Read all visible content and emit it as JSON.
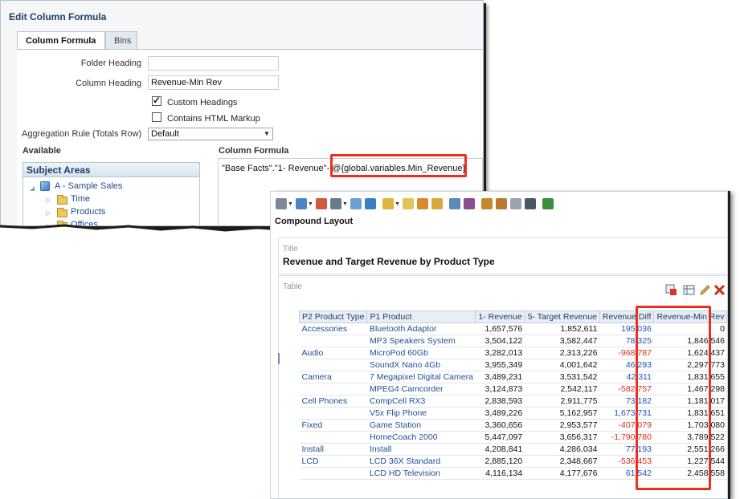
{
  "dialog": {
    "title": "Edit Column Formula",
    "tabs": [
      {
        "label": "Column Formula",
        "active": true
      },
      {
        "label": "Bins",
        "active": false
      }
    ],
    "folder_heading_label": "Folder Heading",
    "folder_heading_value": "",
    "column_heading_label": "Column Heading",
    "column_heading_value": "Revenue-Min Rev",
    "custom_headings_label": "Custom Headings",
    "custom_headings_checked": true,
    "html_markup_label": "Contains HTML Markup",
    "html_markup_checked": false,
    "aggregation_label": "Aggregation Rule (Totals Row)",
    "aggregation_value": "Default",
    "available_label": "Available",
    "subject_areas_label": "Subject Areas",
    "tree": [
      {
        "label": "A - Sample Sales",
        "kind": "subject-area",
        "expanded": true
      },
      {
        "label": "Time",
        "kind": "folder"
      },
      {
        "label": "Products",
        "kind": "folder"
      },
      {
        "label": "Offices",
        "kind": "folder"
      }
    ],
    "column_formula_label": "Column Formula",
    "formula_prefix": "\"Base Facts\".\"1- Revenue\"-",
    "formula_variable": "@{global.variables.Min_Revenue}"
  },
  "panel": {
    "compound_title": "Compound Layout",
    "title_view_label": "Title",
    "view_title": "Revenue and Target Revenue by Product Type",
    "table_view_label": "Table",
    "icons": [
      "format-view-icon",
      "edit-view-icon",
      "pencil-icon",
      "delete-icon"
    ],
    "table": {
      "headers": [
        "P2 Product Type",
        "P1 Product",
        "1- Revenue",
        "5- Target Revenue",
        "Revenue Diff",
        "Revenue-Min Rev"
      ],
      "rows": [
        {
          "type": "Accessories",
          "product": "Bluetooth Adaptor",
          "revenue": "1,657,576",
          "target": "1,852,611",
          "diff": "195,036",
          "diff_neg": false,
          "minrev": "0"
        },
        {
          "type": "",
          "product": "MP3 Speakers System",
          "revenue": "3,504,122",
          "target": "3,582,447",
          "diff": "78,325",
          "diff_neg": false,
          "minrev": "1,846,546"
        },
        {
          "type": "Audio",
          "product": "MicroPod 60Gb",
          "revenue": "3,282,013",
          "target": "2,313,226",
          "diff": "-968,787",
          "diff_neg": true,
          "minrev": "1,624,437"
        },
        {
          "type": "",
          "product": "SoundX Nano 4Gb",
          "revenue": "3,955,349",
          "target": "4,001,642",
          "diff": "46,293",
          "diff_neg": false,
          "minrev": "2,297,773"
        },
        {
          "type": "Camera",
          "product": "7 Megapixel Digital Camera",
          "revenue": "3,489,231",
          "target": "3,531,542",
          "diff": "42,311",
          "diff_neg": false,
          "minrev": "1,831,655"
        },
        {
          "type": "",
          "product": "MPEG4 Camcorder",
          "revenue": "3,124,873",
          "target": "2,542,117",
          "diff": "-582,757",
          "diff_neg": true,
          "minrev": "1,467,298"
        },
        {
          "type": "Cell Phones",
          "product": "CompCell RX3",
          "revenue": "2,838,593",
          "target": "2,911,775",
          "diff": "73,182",
          "diff_neg": false,
          "minrev": "1,181,017"
        },
        {
          "type": "",
          "product": "V5x Flip Phone",
          "revenue": "3,489,226",
          "target": "5,162,957",
          "diff": "1,673,731",
          "diff_neg": false,
          "minrev": "1,831,651"
        },
        {
          "type": "Fixed",
          "product": "Game Station",
          "revenue": "3,360,656",
          "target": "2,953,577",
          "diff": "-407,079",
          "diff_neg": true,
          "minrev": "1,703,080"
        },
        {
          "type": "",
          "product": "HomeCoach 2000",
          "revenue": "5,447,097",
          "target": "3,656,317",
          "diff": "-1,790,780",
          "diff_neg": true,
          "minrev": "3,789,522"
        },
        {
          "type": "Install",
          "product": "Install",
          "revenue": "4,208,841",
          "target": "4,286,034",
          "diff": "77,193",
          "diff_neg": false,
          "minrev": "2,551,266"
        },
        {
          "type": "LCD",
          "product": "LCD 36X Standard",
          "revenue": "2,885,120",
          "target": "2,348,667",
          "diff": "-536,453",
          "diff_neg": true,
          "minrev": "1,227,544"
        },
        {
          "type": "",
          "product": "LCD HD Television",
          "revenue": "4,116,134",
          "target": "4,177,676",
          "diff": "61,542",
          "diff_neg": false,
          "minrev": "2,458,558"
        }
      ]
    }
  },
  "colors": {
    "highlight": "#e8321f",
    "negative": "#e22a1b",
    "positive": "#2050c0",
    "link": "#1f4f96",
    "title_blue": "#1e3f66"
  }
}
